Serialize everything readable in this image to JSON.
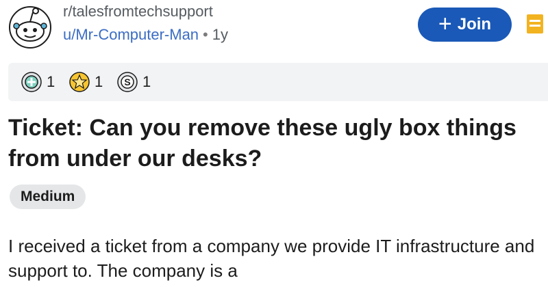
{
  "header": {
    "subreddit": "r/talesfromtechsupport",
    "author": "u/Mr-Computer-Man",
    "separator": "•",
    "age": "1y",
    "join_label": "Join",
    "join_icon": "plus-icon",
    "save_icon": "save-icon",
    "colors": {
      "join_bg": "#1a59b7",
      "author": "#3b6dc4",
      "save": "#f2b320"
    }
  },
  "awards": [
    {
      "icon": "helpful-award-icon",
      "count": "1"
    },
    {
      "icon": "gold-award-icon",
      "count": "1"
    },
    {
      "icon": "silver-award-icon",
      "count": "1"
    }
  ],
  "post": {
    "title": "Ticket: Can you remove these ugly box things from under our desks?",
    "flair": "Medium",
    "body": "I received a ticket from a company we provide IT infrastructure and support to. The company is a"
  }
}
